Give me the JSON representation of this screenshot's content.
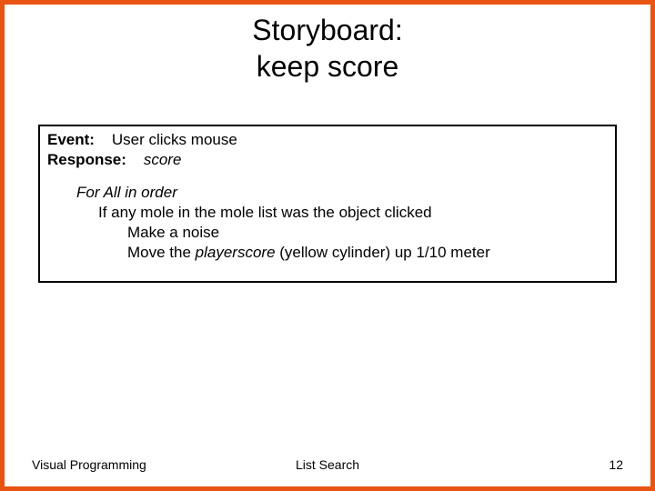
{
  "title_line1": "Storyboard:",
  "title_line2": "keep score",
  "box": {
    "event_label": "Event:",
    "event_text": "User clicks mouse",
    "response_label": "Response:",
    "response_text": "score",
    "loop_header": "For All in order",
    "if_line": "If any mole in the mole list was the object clicked",
    "action1": "Make a noise",
    "action2_pre": "Move the ",
    "action2_var": "playerscore",
    "action2_post": " (yellow cylinder) up 1/10 meter"
  },
  "footer": {
    "left": "Visual Programming",
    "center": "List Search",
    "right": "12"
  }
}
